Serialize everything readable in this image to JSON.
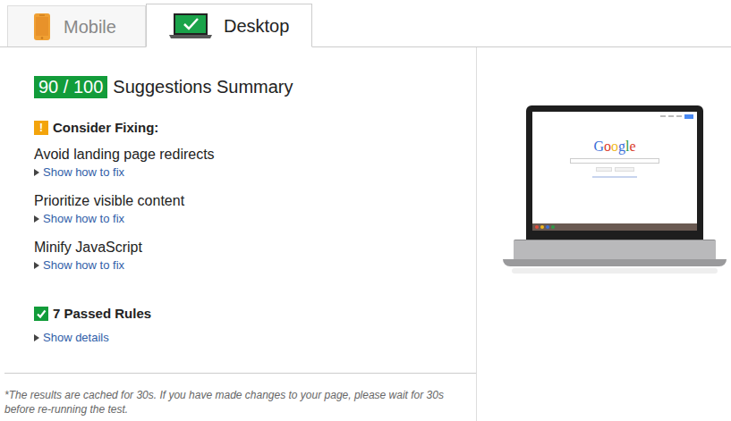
{
  "tabs": [
    {
      "label": "Mobile",
      "selected": false
    },
    {
      "label": "Desktop",
      "selected": true
    }
  ],
  "summary": {
    "score": "90 / 100",
    "title": "Suggestions Summary"
  },
  "consider_fixing": {
    "icon": "!",
    "heading": "Consider Fixing:",
    "items": [
      {
        "title": "Avoid landing page redirects",
        "link": "Show how to fix",
        "expanded": false
      },
      {
        "title": "Prioritize visible content",
        "link": "Show how to fix",
        "expanded": false
      },
      {
        "title": "Minify JavaScript",
        "link": "Show how to fix",
        "expanded": false
      }
    ]
  },
  "passed": {
    "heading": "7 Passed Rules",
    "link": "Show details",
    "expanded": false
  },
  "note": "*The results are cached for 30s. If you have made changes to your page, please wait for 30s before re-running the test.",
  "preview": {
    "logo": [
      {
        "text": "G",
        "color": "#3b6fd8"
      },
      {
        "text": "o",
        "color": "#d93a2b"
      },
      {
        "text": "o",
        "color": "#f1b81c"
      },
      {
        "text": "g",
        "color": "#3b6fd8"
      },
      {
        "text": "l",
        "color": "#2c9a48"
      },
      {
        "text": "e",
        "color": "#d93a2b"
      }
    ]
  }
}
